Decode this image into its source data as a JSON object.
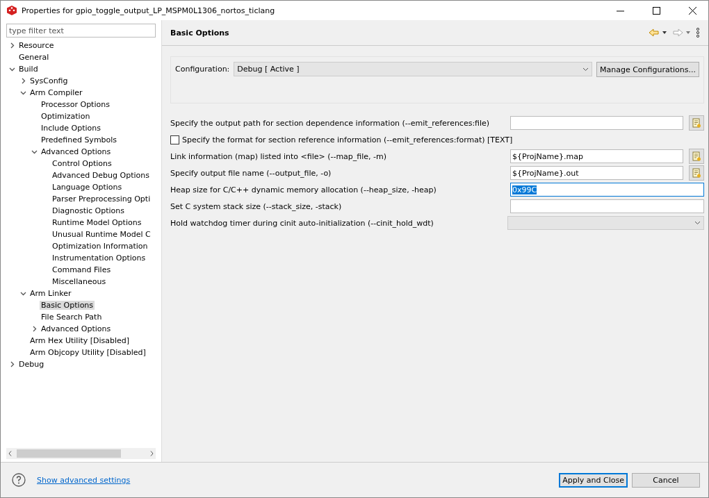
{
  "window": {
    "title": "Properties for gpio_toggle_output_LP_MSPM0L1306_nortos_ticlang"
  },
  "sidebar": {
    "filter": {
      "placeholder": "type filter text"
    },
    "tree": [
      {
        "label": "Resource",
        "expanded": false,
        "selected": false
      },
      {
        "label": "General",
        "selected": false
      },
      {
        "label": "Build",
        "expanded": true,
        "selected": false,
        "children": [
          {
            "label": "SysConfig",
            "expanded": false,
            "selected": false
          },
          {
            "label": "Arm Compiler",
            "expanded": true,
            "selected": false,
            "children": [
              {
                "label": "Processor Options",
                "selected": false
              },
              {
                "label": "Optimization",
                "selected": false
              },
              {
                "label": "Include Options",
                "selected": false
              },
              {
                "label": "Predefined Symbols",
                "selected": false
              },
              {
                "label": "Advanced Options",
                "expanded": true,
                "selected": false,
                "children": [
                  {
                    "label": "Control Options",
                    "selected": false
                  },
                  {
                    "label": "Advanced Debug Options",
                    "selected": false
                  },
                  {
                    "label": "Language Options",
                    "selected": false
                  },
                  {
                    "label": "Parser Preprocessing Opti",
                    "selected": false
                  },
                  {
                    "label": "Diagnostic Options",
                    "selected": false
                  },
                  {
                    "label": "Runtime Model Options",
                    "selected": false
                  },
                  {
                    "label": "Unusual Runtime Model C",
                    "selected": false
                  },
                  {
                    "label": "Optimization Information",
                    "selected": false
                  },
                  {
                    "label": "Instrumentation Options",
                    "selected": false
                  },
                  {
                    "label": "Command Files",
                    "selected": false
                  },
                  {
                    "label": "Miscellaneous",
                    "selected": false
                  }
                ]
              }
            ]
          },
          {
            "label": "Arm Linker",
            "expanded": true,
            "selected": false,
            "children": [
              {
                "label": "Basic Options",
                "selected": true
              },
              {
                "label": "File Search Path",
                "selected": false
              },
              {
                "label": "Advanced Options",
                "expanded": false,
                "selected": false
              }
            ]
          },
          {
            "label": "Arm Hex Utility  [Disabled]",
            "selected": false
          },
          {
            "label": "Arm Objcopy Utility  [Disabled]",
            "selected": false
          }
        ]
      },
      {
        "label": "Debug",
        "expanded": false,
        "selected": false
      }
    ]
  },
  "page": {
    "title": "Basic Options",
    "configuration": {
      "label": "Configuration:",
      "value": "Debug  [ Active ]",
      "button": "Manage Configurations..."
    },
    "options": [
      {
        "kind": "file",
        "label": "Specify the output path for section dependence information (--emit_references:file)",
        "focused": false
      },
      {
        "kind": "checkbox",
        "label": "Specify the format for section reference information (--emit_references:format) [TEXT]",
        "checked": false
      },
      {
        "kind": "file",
        "label": "Link information (map) listed into <file> (--map_file, -m)",
        "value": "${ProjName}.map",
        "focused": false
      },
      {
        "kind": "file",
        "label": "Specify output file name (--output_file, -o)",
        "value": "${ProjName}.out",
        "focused": false
      },
      {
        "kind": "text",
        "label": "Heap size for C/C++ dynamic memory allocation (--heap_size, -heap)",
        "value": "0x99C",
        "focused": true
      },
      {
        "kind": "text",
        "label": "Set C system stack size (--stack_size, -stack)",
        "focused": false
      },
      {
        "kind": "select",
        "label": "Hold watchdog timer during cinit auto-initialization (--cinit_hold_wdt)",
        "disabled": true
      }
    ]
  },
  "footer": {
    "link": "Show advanced settings",
    "buttons": [
      {
        "label": "Apply and Close",
        "default": true
      },
      {
        "label": "Cancel",
        "default": false
      }
    ]
  }
}
